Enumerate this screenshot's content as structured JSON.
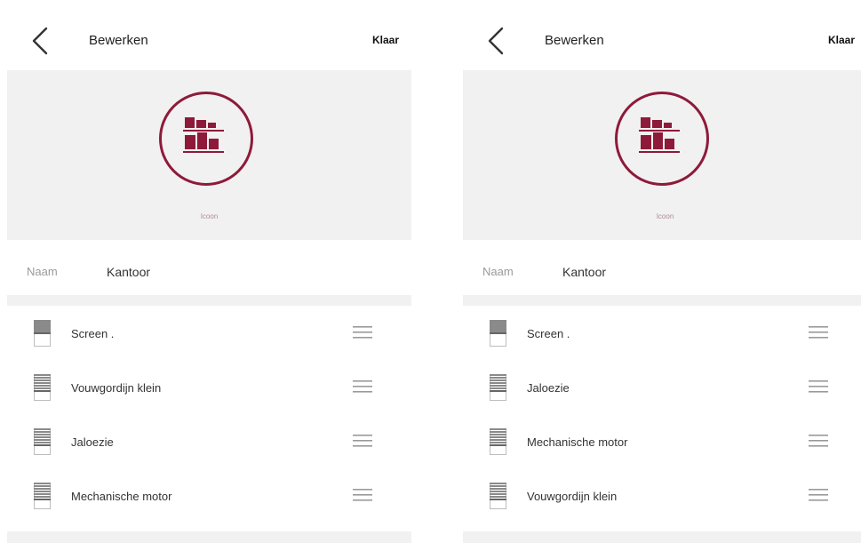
{
  "colors": {
    "accent": "#8e1a3a",
    "panel_bg": "#f1f1f1"
  },
  "panels": [
    {
      "back_icon": "chevron-left-icon",
      "title": "Bewerken",
      "done_label": "Klaar",
      "room_icon": "shelves-icon",
      "icon_caption": "Icoon",
      "name_label": "Naam",
      "name_value": "Kantoor",
      "items": [
        {
          "label": "Screen .",
          "icon": "screen-shade-icon"
        },
        {
          "label": "Vouwgordijn  klein",
          "icon": "blind-shade-icon"
        },
        {
          "label": "Jaloezie",
          "icon": "blind-shade-icon"
        },
        {
          "label": "Mechanische motor",
          "icon": "blind-shade-icon"
        }
      ]
    },
    {
      "back_icon": "chevron-left-icon",
      "title": "Bewerken",
      "done_label": "Klaar",
      "room_icon": "shelves-icon",
      "icon_caption": "Icoon",
      "name_label": "Naam",
      "name_value": "Kantoor",
      "items": [
        {
          "label": "Screen .",
          "icon": "screen-shade-icon"
        },
        {
          "label": "Jaloezie",
          "icon": "blind-shade-icon"
        },
        {
          "label": "Mechanische motor",
          "icon": "blind-shade-icon"
        },
        {
          "label": "Vouwgordijn  klein",
          "icon": "blind-shade-icon"
        }
      ]
    }
  ]
}
